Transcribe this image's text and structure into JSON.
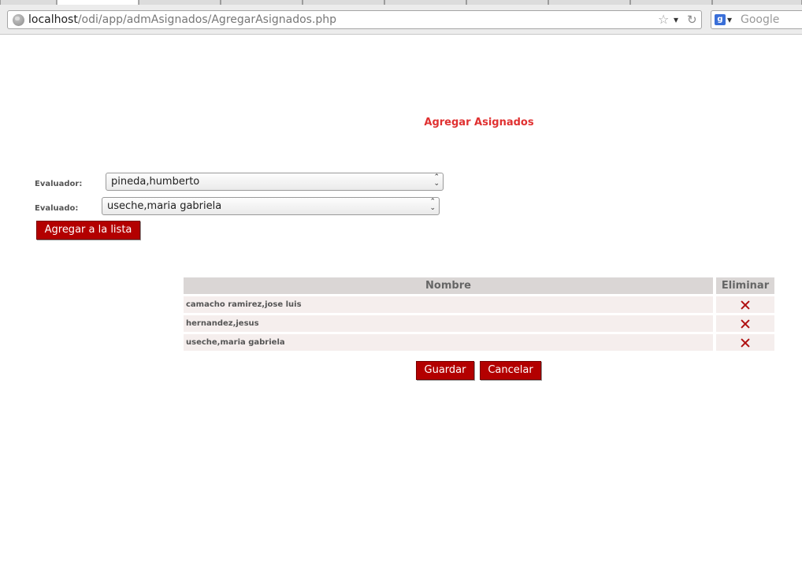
{
  "browser": {
    "url_host": "localhost",
    "url_path": "/odi/app/admAsignados/AgregarAsignados.php",
    "search_placeholder": "Google"
  },
  "page": {
    "title": "Agregar Asignados"
  },
  "form": {
    "evaluador_label": "Evaluador:",
    "evaluador_value": "pineda,humberto",
    "evaluado_label": "Evaluado:",
    "evaluado_value": "useche,maria gabriela",
    "add_button": "Agregar a la lista"
  },
  "table": {
    "headers": [
      "Nombre",
      "Eliminar"
    ],
    "rows": [
      {
        "nombre": "camacho ramirez,jose luis"
      },
      {
        "nombre": "hernandez,jesus"
      },
      {
        "nombre": "useche,maria gabriela"
      }
    ]
  },
  "actions": {
    "save": "Guardar",
    "cancel": "Cancelar"
  }
}
